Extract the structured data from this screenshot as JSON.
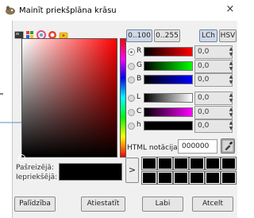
{
  "window": {
    "title": "Mainīt priekšplāna krāsu",
    "close_glyph": "×"
  },
  "picker_modes": [
    "gimp-picker-icon",
    "palette-icon",
    "color-wheel-icon",
    "watercolor-icon",
    "scales-icon"
  ],
  "sv_gradient": {
    "hue_color": "#ff0000"
  },
  "range_buttons": {
    "range_100": "0..100",
    "range_255": "0..255"
  },
  "mode_buttons": {
    "lch": "LCh",
    "hsv": "HSV"
  },
  "channels": [
    {
      "key": "r",
      "label": "R",
      "value": "0,0",
      "selected": true
    },
    {
      "key": "g",
      "label": "G",
      "value": "0,0",
      "selected": false
    },
    {
      "key": "b",
      "label": "B",
      "value": "0,0",
      "selected": false
    },
    {
      "key": "l",
      "label": "L",
      "value": "0,0",
      "selected": false
    },
    {
      "key": "c",
      "label": "C",
      "value": "0,0",
      "selected": false
    },
    {
      "key": "h",
      "label": "h",
      "value": "0,0",
      "selected": false
    }
  ],
  "spin_glyphs": {
    "up": "▲",
    "down": "▼"
  },
  "html_notation": {
    "label": "HTML notācija:",
    "value": "000000"
  },
  "current_label": "Pašreizējā:",
  "old_label": "Iepriekšējā:",
  "current_color": "#000000",
  "history": {
    "arrow": ">",
    "colors": [
      "#000000",
      "#000000",
      "#000000",
      "#000000",
      "#000000",
      "#000000",
      "#000000",
      "#000000",
      "#000000",
      "#000000",
      "#000000",
      "#000000"
    ]
  },
  "buttons": {
    "help": "Palīdzība",
    "reset": "Atiestatīt",
    "ok": "Labi",
    "cancel": "Atcelt"
  }
}
